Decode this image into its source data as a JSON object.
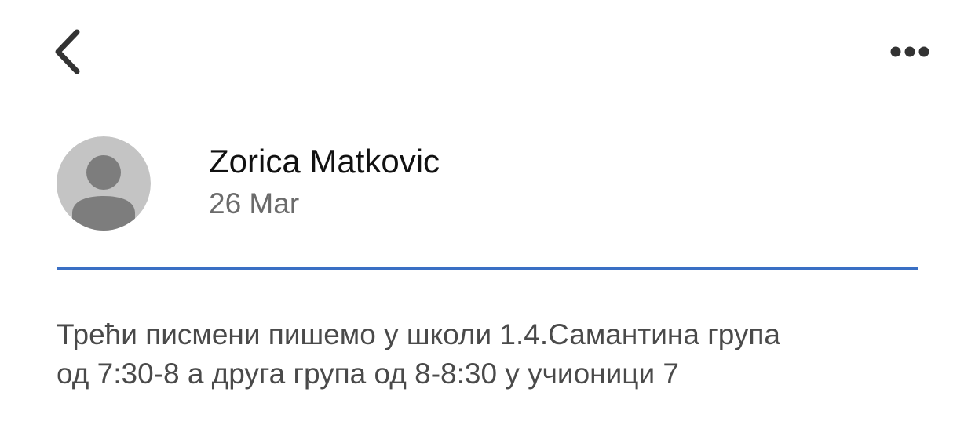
{
  "header": {
    "back_icon": "chevron-left-icon",
    "more_icon": "more-horizontal-icon"
  },
  "post": {
    "author": "Zorica Matkovic",
    "date": "26 Mar",
    "avatar_icon": "person-placeholder-icon",
    "message_lines": [
      "Трећи писмени пишемо у школи 1.4.Самантина група",
      "од 7:30-8 а друга група од 8-8:30 у учионици 7"
    ]
  },
  "colors": {
    "divider": "#3a6fc4",
    "avatar_background": "#c4c4c4",
    "avatar_figure": "#7d7d7d",
    "icon": "#333333"
  }
}
